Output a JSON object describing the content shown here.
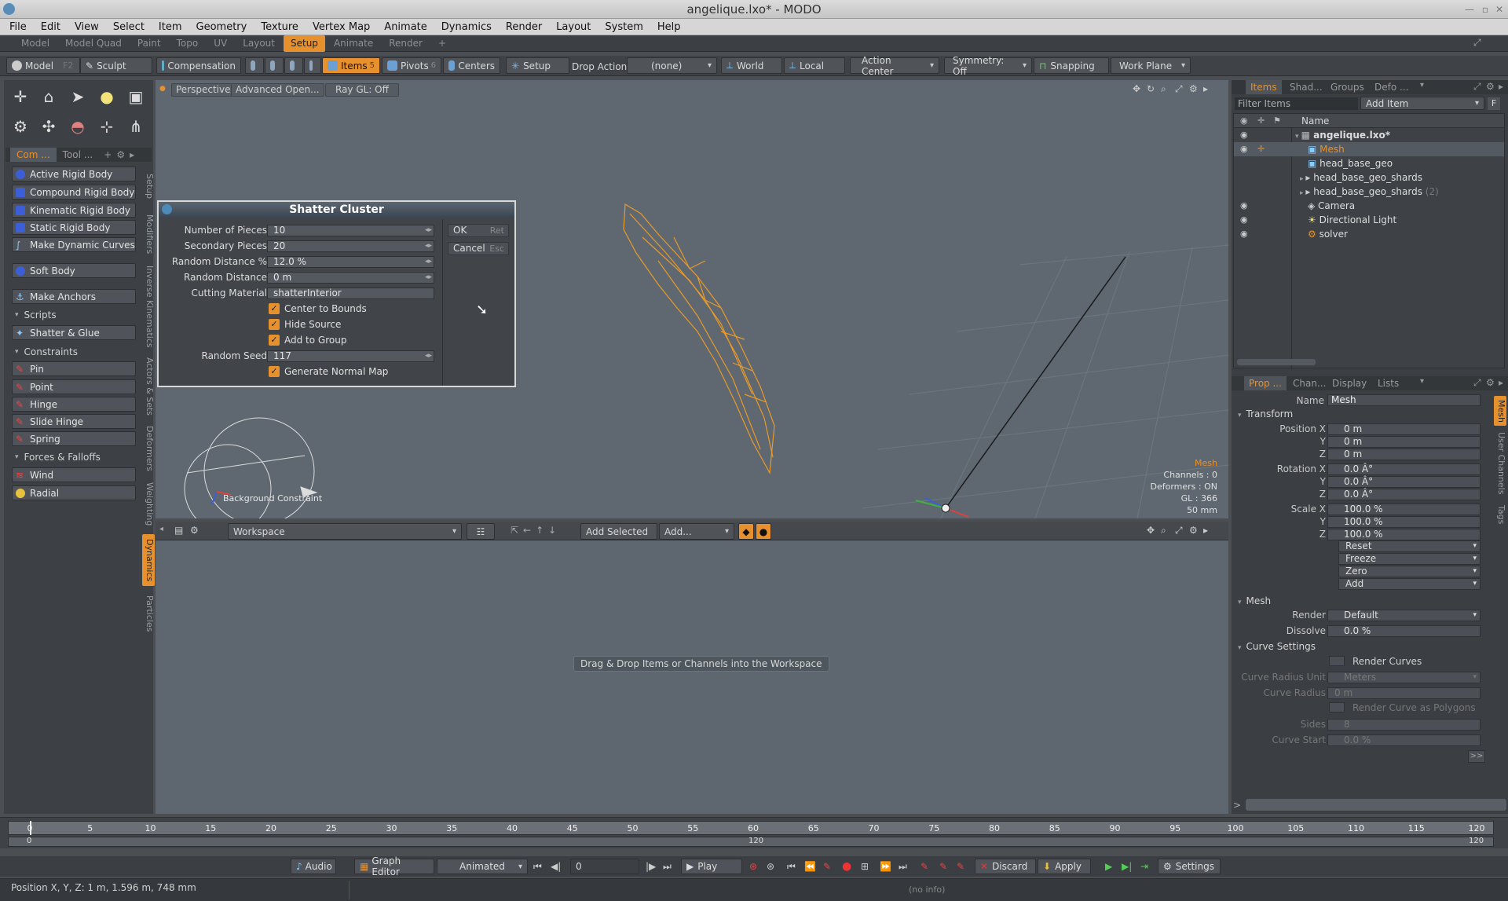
{
  "window": {
    "title": "angelique.lxo* - MODO"
  },
  "menu": [
    "File",
    "Edit",
    "View",
    "Select",
    "Item",
    "Geometry",
    "Texture",
    "Vertex Map",
    "Animate",
    "Dynamics",
    "Render",
    "Layout",
    "System",
    "Help"
  ],
  "layout_tabs": [
    "Model",
    "Model Quad",
    "Paint",
    "Topo",
    "UV",
    "Layout",
    "Setup",
    "Animate",
    "Render"
  ],
  "active_layout_tab": "Setup",
  "toolbar": {
    "model": "Model",
    "model_key": "F2",
    "sculpt": "Sculpt",
    "compensation": "Compensation",
    "items": "Items",
    "items_key": "5",
    "pivots": "Pivots",
    "pivots_key": "6",
    "centers": "Centers",
    "setup": "Setup",
    "drop_action_label": "Drop Action",
    "drop_action_value": "(none)",
    "world": "World",
    "local": "Local",
    "action_center": "Action Center",
    "symmetry": "Symmetry: Off",
    "snapping": "Snapping",
    "work_plane": "Work Plane"
  },
  "left_panel": {
    "tabs": [
      "Com ...",
      "Tool ..."
    ],
    "buttons": {
      "active_rigid_body": "Active Rigid Body",
      "compound_rigid_body": "Compound Rigid Body",
      "kinematic_rigid_body": "Kinematic Rigid Body",
      "static_rigid_body": "Static Rigid Body",
      "make_dynamic_curves": "Make Dynamic Curves",
      "soft_body": "Soft Body",
      "make_anchors": "Make Anchors",
      "shatter_glue": "Shatter & Glue",
      "pin": "Pin",
      "point": "Point",
      "hinge": "Hinge",
      "slide_hinge": "Slide Hinge",
      "spring": "Spring",
      "wind": "Wind",
      "radial": "Radial"
    },
    "headings": {
      "scripts": "Scripts",
      "constraints": "Constraints",
      "forces": "Forces & Falloffs"
    },
    "vtabs": [
      "Setup",
      "Modifiers",
      "Inverse Kinematics",
      "Actors & Sets",
      "Deformers",
      "Weighting",
      "Dynamics",
      "Particles"
    ]
  },
  "viewport": {
    "perspective": "Perspective",
    "advanced": "Advanced Open...",
    "raygl": "Ray GL: Off",
    "background_constraint": "Background Constraint",
    "info": {
      "item": "Mesh",
      "channels": "Channels : 0",
      "deformers": "Deformers : ON",
      "gl": "GL : 366",
      "scale": "50 mm"
    }
  },
  "dialog": {
    "title": "Shatter Cluster",
    "fields": {
      "pieces_label": "Number of Pieces",
      "pieces": "10",
      "secondary_label": "Secondary Pieces",
      "secondary": "20",
      "rdist_pct_label": "Random Distance %",
      "rdist_pct": "12.0 %",
      "rdist_label": "Random Distance",
      "rdist": "0 m",
      "material_label": "Cutting Material",
      "material": "shatterInterior",
      "seed_label": "Random Seed",
      "seed": "117"
    },
    "checks": {
      "center": "Center to Bounds",
      "hide": "Hide Source",
      "group": "Add to Group",
      "normal": "Generate Normal Map"
    },
    "ok": "OK",
    "ok_key": "Ret",
    "cancel": "Cancel",
    "cancel_key": "Esc"
  },
  "workspace": {
    "selector": "Workspace",
    "add_selected": "Add Selected",
    "add": "Add...",
    "hint": "Drag & Drop Items or Channels into the Workspace"
  },
  "items_panel": {
    "tabs": [
      "Items",
      "Shad...",
      "Groups",
      "Defo ..."
    ],
    "filter": "Filter Items",
    "add_item": "Add Item",
    "f_btn": "F",
    "col_name": "Name",
    "tree": {
      "root": "angelique.lxo*",
      "mesh": "Mesh",
      "head": "head_base_geo",
      "shards": "head_base_geo_shards",
      "shards2": "head_base_geo_shards",
      "shards2_count": "(2)",
      "camera": "Camera",
      "light": "Directional Light",
      "solver": "solver"
    }
  },
  "props": {
    "tabs": [
      "Prop ...",
      "Chan...",
      "Display",
      "Lists"
    ],
    "name_label": "Name",
    "name": "Mesh",
    "transform": "Transform",
    "position_label": "Position X",
    "rotation_label": "Rotation X",
    "scale_label": "Scale X",
    "y": "Y",
    "z": "Z",
    "pos": [
      "0 m",
      "0 m",
      "0 m"
    ],
    "rot": [
      "0.0 Â°",
      "0.0 Â°",
      "0.0 Â°"
    ],
    "scl": [
      "100.0 %",
      "100.0 %",
      "100.0 %"
    ],
    "reset": "Reset",
    "freeze": "Freeze",
    "zero": "Zero",
    "add": "Add",
    "mesh": "Mesh",
    "render_label": "Render",
    "render": "Default",
    "dissolve_label": "Dissolve",
    "dissolve": "0.0 %",
    "curve": "Curve Settings",
    "render_curves": "Render Curves",
    "curve_radius_unit_label": "Curve Radius Unit",
    "curve_radius_unit": "Meters",
    "curve_radius_label": "Curve Radius",
    "curve_radius": "0 m",
    "render_poly": "Render Curve as Polygons",
    "sides_label": "Sides",
    "sides": "8",
    "curve_start_label": "Curve Start",
    "curve_start": "0.0 %",
    "more": ">>",
    "vtabs": [
      "Mesh",
      "User Channels",
      "Tags"
    ],
    "cmd_prompt": ">"
  },
  "timeline": {
    "ticks": [
      "0",
      "5",
      "10",
      "15",
      "20",
      "25",
      "30",
      "35",
      "40",
      "45",
      "50",
      "55",
      "60",
      "65",
      "70",
      "75",
      "80",
      "85",
      "90",
      "95",
      "100",
      "105",
      "110",
      "115",
      "120"
    ],
    "sub_start": "0",
    "sub_mid": "120",
    "sub_end": "120"
  },
  "bottom": {
    "audio": "Audio",
    "graph": "Graph Editor",
    "animated": "Animated",
    "frame": "0",
    "play": "Play",
    "discard": "Discard",
    "apply": "Apply",
    "settings": "Settings"
  },
  "status": {
    "left": "Position X, Y, Z:  1 m, 1.596 m, 748 mm",
    "center": "(no info)"
  }
}
